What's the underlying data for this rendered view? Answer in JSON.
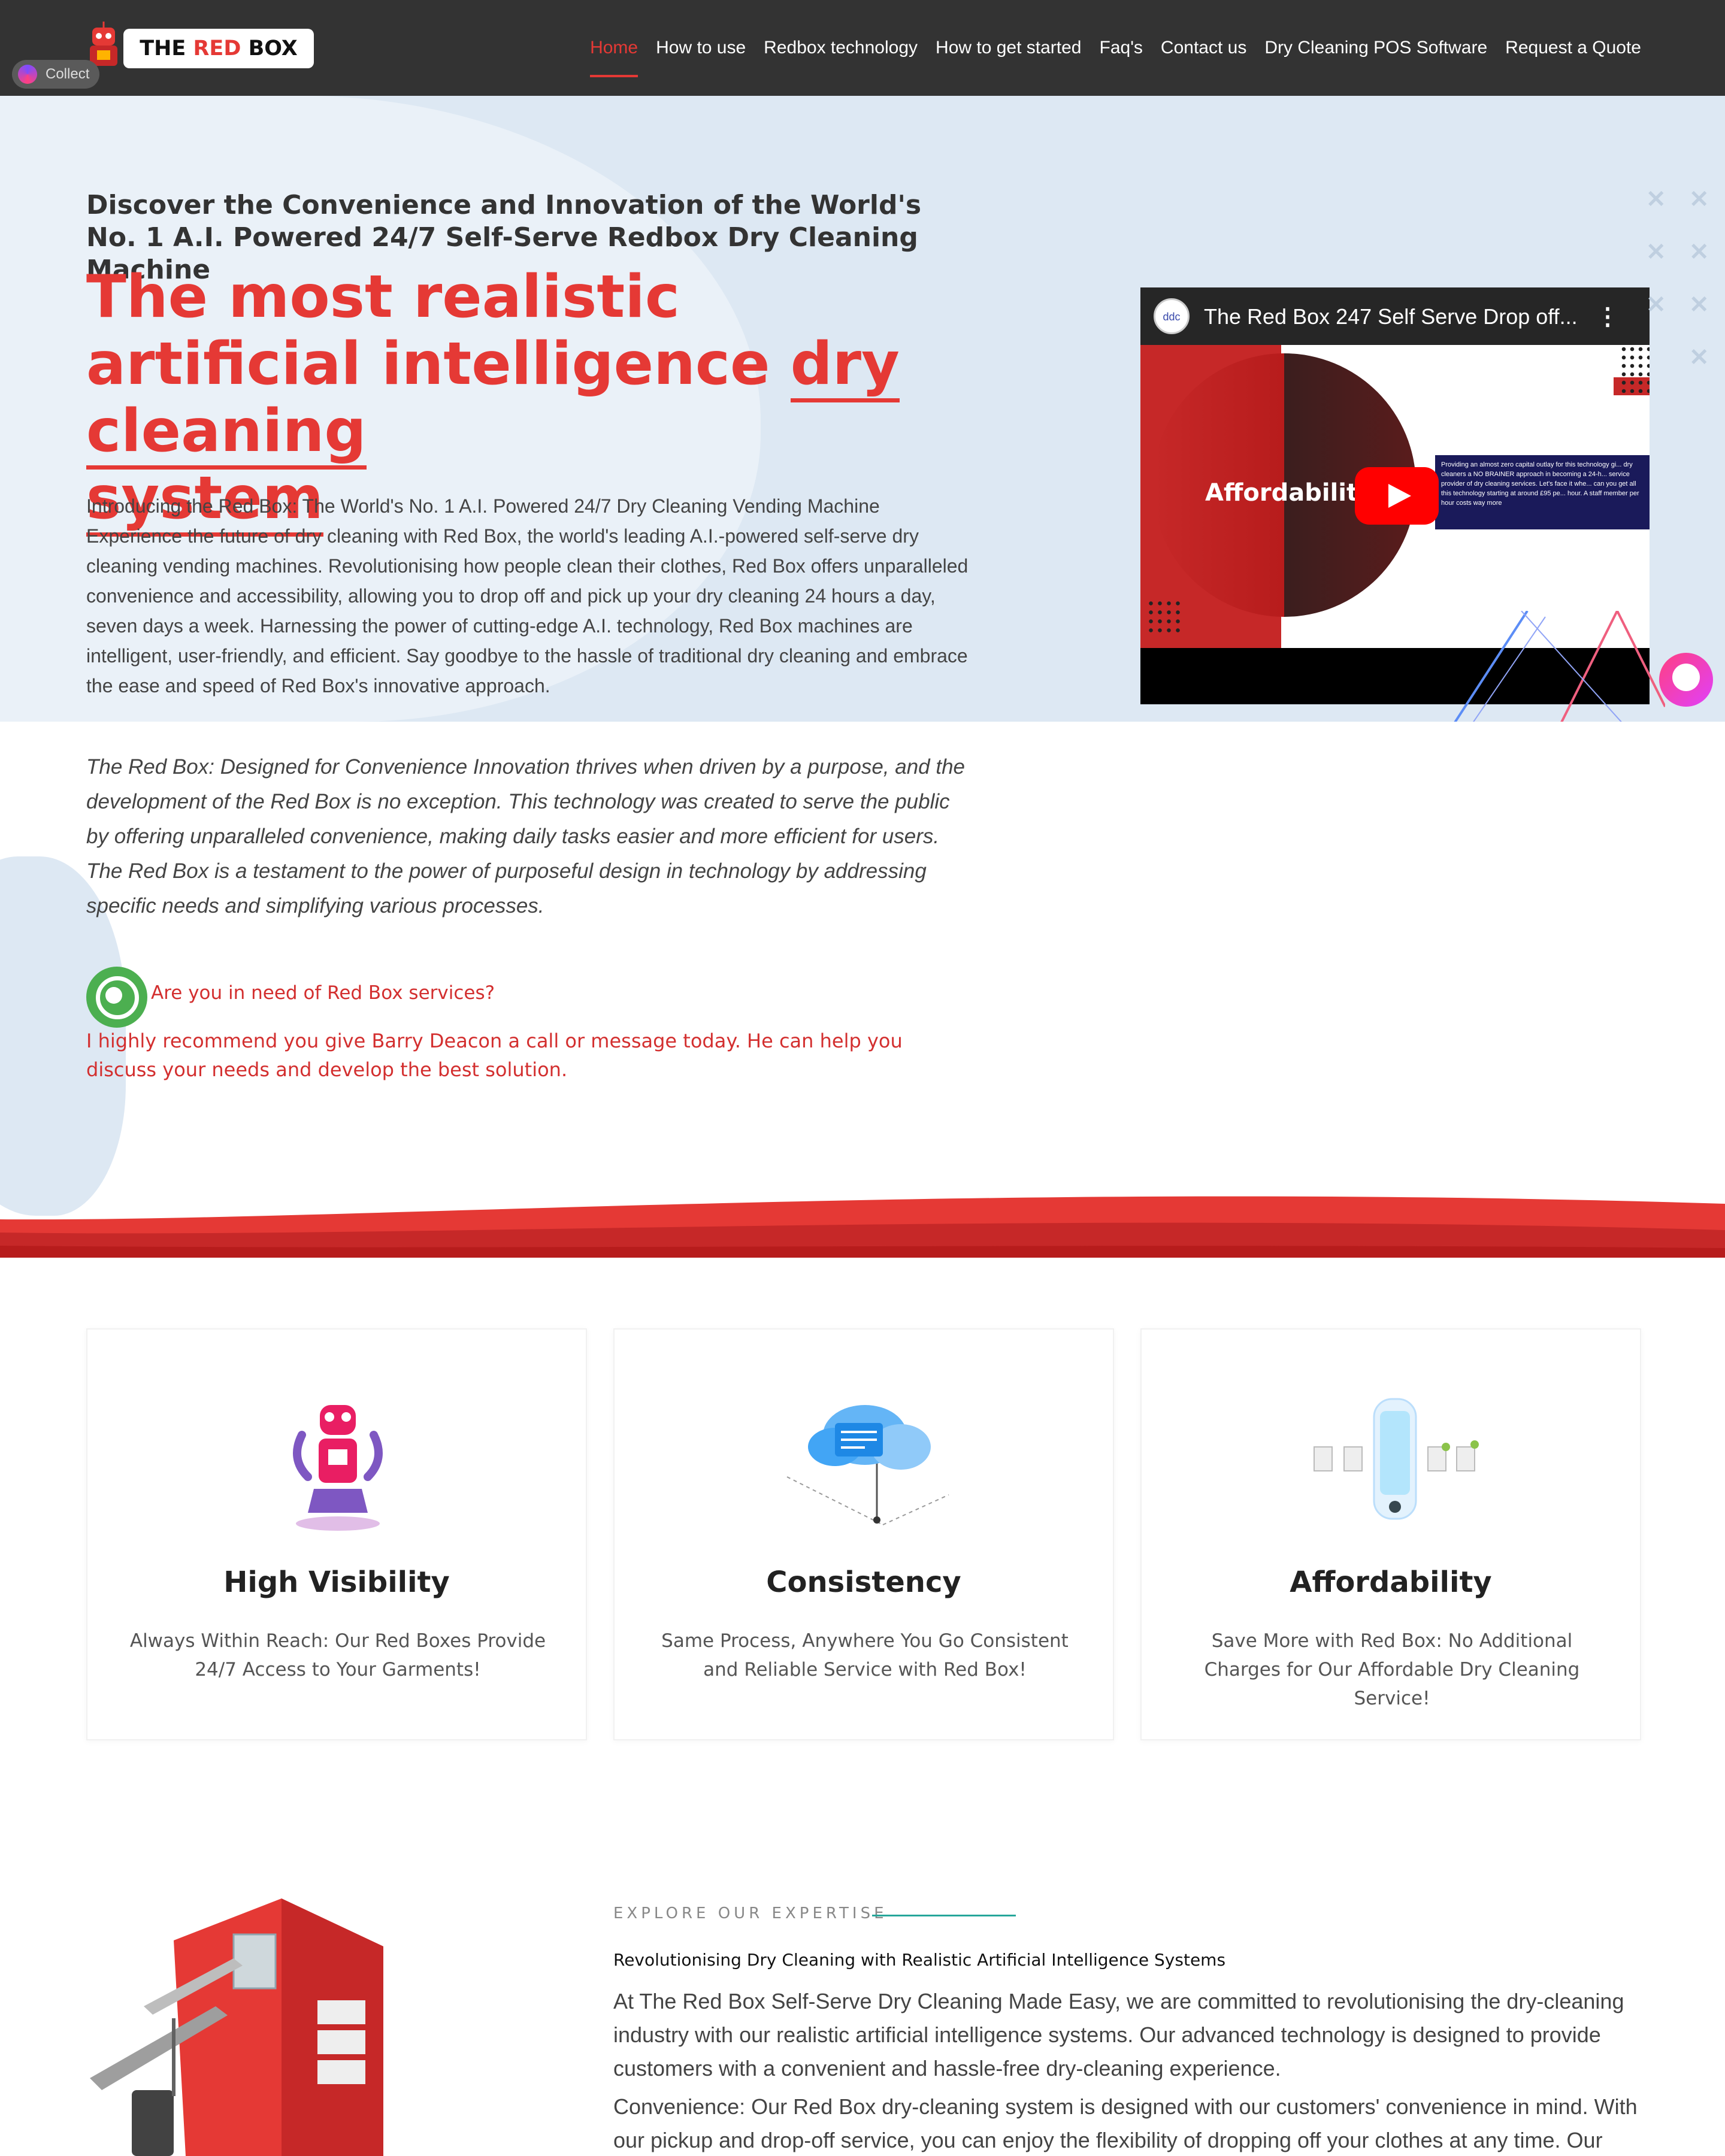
{
  "nav": {
    "logo_prefix": "THE ",
    "logo_red": "RED",
    "logo_suffix": " BOX",
    "collect_label": "Collect",
    "items": [
      {
        "label": "Home",
        "active": true
      },
      {
        "label": "How to use"
      },
      {
        "label": "Redbox technology"
      },
      {
        "label": "How to get started"
      },
      {
        "label": "Faq's"
      },
      {
        "label": "Contact us"
      },
      {
        "label": "Dry Cleaning POS Software"
      },
      {
        "label": "Request a Quote"
      }
    ]
  },
  "hero": {
    "kicker": "Discover the Convenience and Innovation of the World's No. 1 A.I. Powered 24/7 Self-Serve Redbox Dry Cleaning Machine",
    "title_part1": "The most realistic artificial intelligence ",
    "title_underlined_1": "dry cleaning",
    "title_underlined_2": "system",
    "description": "Introducing the Red Box: The World's No. 1 A.I. Powered 24/7 Dry Cleaning Vending Machine Experience the future of dry cleaning with Red Box, the world's leading A.I.-powered self-serve dry cleaning vending machines. Revolutionising how people clean their clothes, Red Box offers unparalleled convenience and accessibility, allowing you to drop off and pick up your dry cleaning 24 hours a day, seven days a week. Harnessing the power of cutting-edge A.I. technology, Red Box machines are intelligent, user-friendly, and efficient. Say goodbye to the hassle of traditional dry cleaning and embrace the ease and speed of Red Box's innovative approach.",
    "video": {
      "title": "The Red Box 247 Self Serve Drop off...",
      "channel_avatar": "ddc",
      "overlay_word": "Affordabilit",
      "panel_text": "Providing an almost zero capital outlay for this technology gi... dry cleaners a NO BRAINER approach in becoming a 24-h... service provider of dry cleaning services. Let's face it whe... can you get all this technology starting at around £95 pe... hour. A staff member per hour costs way more"
    }
  },
  "intro": {
    "paragraph": "The Red Box: Designed for Convenience Innovation thrives when driven by a purpose, and the development of the Red Box is no exception. This technology was created to serve the public by offering unparalleled convenience, making daily tasks easier and more efficient for users. The Red Box is a testament to the power of purposeful design in technology by addressing specific needs and simplifying various processes.",
    "whatsapp_question": "Are you in need of Red Box services?",
    "whatsapp_text": "I highly recommend you give Barry Deacon a call or message today. He can help you discuss your needs and develop the best solution."
  },
  "features": [
    {
      "title": "High Visibility",
      "description": "Always Within Reach: Our Red Boxes Provide 24/7 Access to Your Garments!",
      "icon": "robot-icon"
    },
    {
      "title": "Consistency",
      "description": "Same Process, Anywhere You Go Consistent and Reliable Service with Red Box!",
      "icon": "cloud-icon"
    },
    {
      "title": "Affordability",
      "description": "Save More with Red Box: No Additional Charges for Our Affordable Dry Cleaning Service!",
      "icon": "documents-icon"
    }
  ],
  "expertise": {
    "kicker": "EXPLORE OUR EXPERTISE",
    "subtitle": "Revolutionising Dry Cleaning with Realistic Artificial Intelligence Systems",
    "paragraph1": "At The Red Box Self-Serve Dry Cleaning Made Easy, we are committed to revolutionising the dry-cleaning industry with our realistic artificial intelligence systems. Our advanced technology is designed to provide customers with a convenient and hassle-free dry-cleaning experience.",
    "paragraph2": "Convenience: Our Red Box dry-cleaning system is designed with our customers' convenience in mind. With our pickup and drop-off service, you can enjoy the flexibility of dropping off your clothes at any time. Our"
  },
  "colors": {
    "brand_red": "#e53935",
    "nav_bg": "#333333",
    "hero_bg": "#dde8f3",
    "accent_teal": "#26a69a"
  }
}
